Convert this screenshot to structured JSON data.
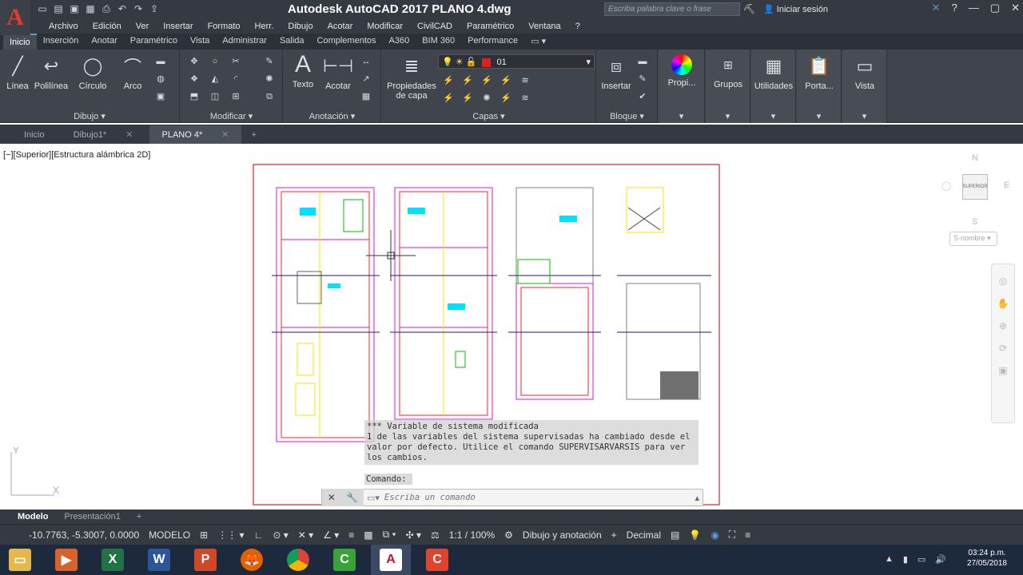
{
  "window": {
    "title": "Autodesk AutoCAD 2017    PLANO 4.dwg",
    "search_placeholder": "Escriba palabra clave o frase",
    "signin_label": "Iniciar sesión"
  },
  "menu": [
    "Archivo",
    "Edición",
    "Ver",
    "Insertar",
    "Formato",
    "Herr.",
    "Dibujo",
    "Acotar",
    "Modificar",
    "CivilCAD",
    "Paramétrico",
    "Ventana",
    "?"
  ],
  "ribbon_tabs": [
    "Inicio",
    "Inserción",
    "Anotar",
    "Paramétrico",
    "Vista",
    "Administrar",
    "Salida",
    "Complementos",
    "A360",
    "BIM 360",
    "Performance"
  ],
  "ribbon": {
    "dibujo": {
      "title": "Dibujo",
      "linea": "Línea",
      "polilinea": "Polilínea",
      "circulo": "Círculo",
      "arco": "Arco"
    },
    "modificar": {
      "title": "Modificar"
    },
    "anotacion": {
      "title": "Anotación",
      "texto": "Texto",
      "acotar": "Acotar"
    },
    "capas": {
      "title": "Capas",
      "propiedades": "Propiedades de capa",
      "current_layer": "01"
    },
    "bloque": {
      "title": "Bloque",
      "insertar": "Insertar"
    },
    "propi": "Propi...",
    "grupos": "Grupos",
    "utilidades": "Utilidades",
    "porta": "Porta...",
    "vista": "Vista"
  },
  "doc_tabs": [
    {
      "label": "Inicio"
    },
    {
      "label": "Dibujo1*"
    },
    {
      "label": "PLANO 4*"
    }
  ],
  "viewport": {
    "label": "[−][Superior][Estructura alámbrica 2D]",
    "viewcube_top": "SUPERIOR",
    "compass": {
      "n": "N",
      "s": "S",
      "e": "E"
    },
    "wcs": "S-nombre"
  },
  "command": {
    "history": "*** Variable de sistema modificada\n1 de las variables del sistema supervisadas ha cambiado desde el valor por defecto. Utilice el comando SUPERVISARVARSIS para ver los cambios.",
    "prompt": "Comando:",
    "placeholder": "Escriba un comando"
  },
  "layout_tabs": [
    "Modelo",
    "Presentación1"
  ],
  "status": {
    "coords": "-10.7763, -5.3007, 0.0000",
    "mode": "MODELO",
    "scale": "1:1 / 100%",
    "workspace": "Dibujo y anotación",
    "units": "Decimal"
  },
  "taskbar": {
    "time": "03:24 p.m.",
    "date": "27/05/2018"
  },
  "colors": {
    "accent": "#5c9be0",
    "title_bg": "#353a42",
    "ribbon_bg": "#3f444d",
    "taskbar_bg": "#1d2a3e"
  }
}
